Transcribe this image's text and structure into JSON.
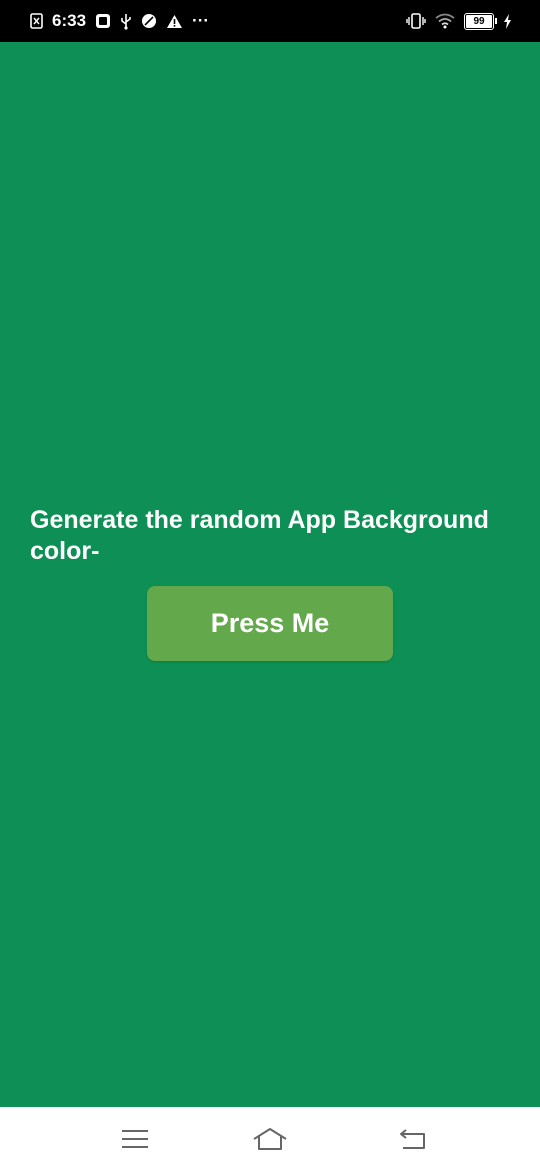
{
  "status_bar": {
    "time": "6:33",
    "more": "···",
    "battery_level": "99"
  },
  "app": {
    "background_color": "#0e8f55",
    "prompt_text": "Generate the random App Background color-",
    "button_label": "Press Me",
    "button_color": "#63a94c"
  },
  "nav_bar": {
    "icons": [
      "menu-icon",
      "home-icon",
      "back-icon"
    ]
  }
}
